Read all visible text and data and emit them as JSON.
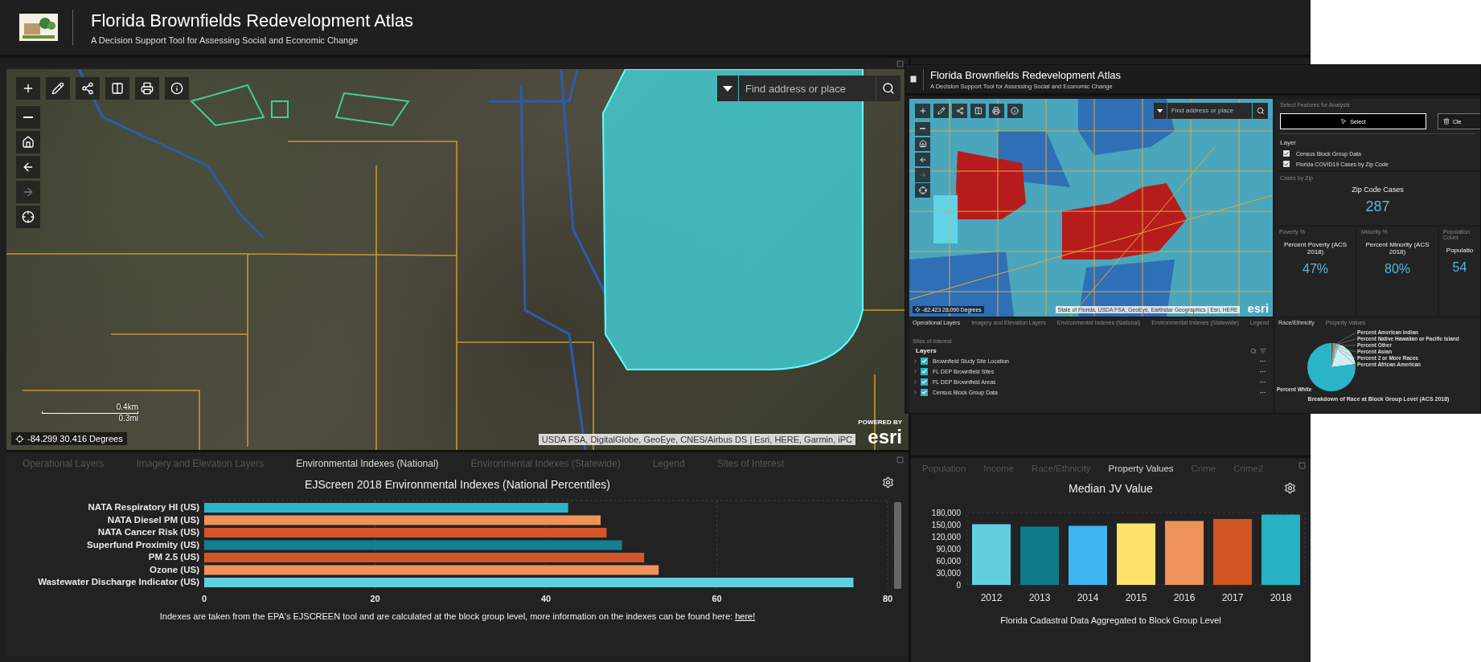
{
  "header": {
    "title": "Florida Brownfields Redevelopment Atlas",
    "subtitle": "A Decision Support Tool for Assessing Social and Economic Change"
  },
  "map": {
    "search": {
      "placeholder": "Find address or place"
    },
    "scale": [
      "0.4km",
      "0.3mi"
    ],
    "coordinates": "-84.299 30.416 Degrees",
    "attribution": "USDA FSA, DigitalGlobe, GeoEye, CNES/Airbus DS | Esri, HERE, Garmin, iPC",
    "powered_by": "POWERED BY",
    "logo": "esri"
  },
  "environment_panel": {
    "tabs": [
      {
        "label": "Operational Layers",
        "selected": false
      },
      {
        "label": "Imagery and Elevation Layers",
        "selected": false
      },
      {
        "label": "Environmental Indexes (National)",
        "selected": true
      },
      {
        "label": "Environmental Indexes (Statewide)",
        "selected": false
      },
      {
        "label": "Legend",
        "selected": false
      },
      {
        "label": "Sites of Interest",
        "selected": false
      }
    ],
    "chart_data": {
      "type": "bar",
      "orientation": "horizontal",
      "title": "EJScreen 2018 Environmental Indexes (National Percentiles)",
      "categories": [
        "NATA Respiratory HI (US)",
        "NATA Diesel PM (US)",
        "NATA Cancer Risk (US)",
        "Superfund Proximity (US)",
        "PM 2.5 (US)",
        "Ozone (US)",
        "Wastewater Discharge Indicator (US)"
      ],
      "values": [
        42.6,
        46.4,
        47.1,
        48.9,
        51.5,
        53.2,
        76
      ],
      "xlim": [
        0,
        80
      ],
      "xticks": [
        0,
        20,
        40,
        60,
        80
      ],
      "grid": true
    },
    "bars": [
      {
        "color": "#2bb5c8"
      },
      {
        "color": "#f0935a"
      },
      {
        "color": "#d2562a"
      },
      {
        "color": "#137f92"
      },
      {
        "color": "#d2562a"
      },
      {
        "color": "#f0935a"
      },
      {
        "color": "#5fcfdf"
      }
    ],
    "note": {
      "text": "Indexes are taken from the EPA's EJSCREEN tool and are calculated at the block group level, more information on the indexes can be found here:",
      "link": "here!"
    }
  },
  "property_panel": {
    "tabs": [
      {
        "label": "Population",
        "selected": false
      },
      {
        "label": "Income",
        "selected": false
      },
      {
        "label": "Race/Ethnicity",
        "selected": false
      },
      {
        "label": "Property Values",
        "selected": true
      },
      {
        "label": "Crime",
        "selected": false
      },
      {
        "label": "Crime2",
        "selected": false
      }
    ],
    "chart_data": {
      "type": "bar",
      "title": "Median JV Value",
      "xlabel": "Florida Cadastral Data Aggregated to Block Group Level",
      "categories": [
        "2012",
        "2013",
        "2014",
        "2015",
        "2016",
        "2017",
        "2018"
      ],
      "values": [
        151000,
        145000,
        147000,
        153000,
        159000,
        164000,
        175000
      ],
      "grid": true,
      "ylim": [
        0,
        180000
      ],
      "yticks": [
        {
          "value": 0,
          "label": "0"
        },
        {
          "value": 30000,
          "label": "30,000"
        },
        {
          "value": 60000,
          "label": "60,000"
        },
        {
          "value": 90000,
          "label": "90,000"
        },
        {
          "value": 120000,
          "label": "120,000"
        },
        {
          "value": 150000,
          "label": "150,000"
        },
        {
          "value": 180000,
          "label": "180,000"
        }
      ]
    },
    "bars": [
      {
        "color": "#62cfe0"
      },
      {
        "color": "#0e7a8c"
      },
      {
        "color": "#3fb6ef"
      },
      {
        "color": "#fbe26a"
      },
      {
        "color": "#f0935a"
      },
      {
        "color": "#cf5420"
      },
      {
        "color": "#27b3c5"
      }
    ]
  },
  "inset": {
    "title": "Florida Brownfields Redevelopment Atlas",
    "subtitle": "A Decision Support Tool for Assessing Social and Economic Change",
    "map": {
      "search": {
        "placeholder": "Find address or place"
      },
      "coordinates": "-82.423 28.090 Degrees",
      "attribution": "State of Florida, USDA FSA, GeoEye, Earthstar Geographics | Esri, HERE",
      "logo": "esri"
    },
    "analysis": {
      "heading": "Select Features for Analysis",
      "buttons": [
        {
          "label": "Select",
          "kind": "select"
        },
        {
          "label": "Cle",
          "kind": "clear"
        }
      ],
      "layer_heading": "Layer",
      "layers": [
        {
          "label": "Census Block Group Data",
          "checked": true
        },
        {
          "label": "Florida COVID19 Cases by Zip Code",
          "checked": true
        }
      ]
    },
    "cases": {
      "heading": "Cases by Zip",
      "title": "Zip Code Cases",
      "value": "287"
    },
    "cards": [
      {
        "heading": "Poverty %",
        "title": "Percent Poverty (ACS 2018)",
        "value": "47%"
      },
      {
        "heading": "Minority %",
        "title": "Percent Minority (ACS 2018)",
        "value": "80%"
      },
      {
        "heading": "Population Count",
        "title": "Populatio",
        "value": "54"
      }
    ],
    "layers_panel": {
      "tabs": [
        {
          "label": "Operational Layers",
          "selected": true
        },
        {
          "label": "Imagery and Elevation Layers",
          "selected": false
        },
        {
          "label": "Environmental Indexes (National)",
          "selected": false
        },
        {
          "label": "Environmental Indexes (Statewide)",
          "selected": false
        },
        {
          "label": "Legend",
          "selected": false
        },
        {
          "label": "Sites of Interest",
          "selected": false
        }
      ],
      "heading": "Layers",
      "items": [
        {
          "label": "Brownfield Study Site Location",
          "checked": true
        },
        {
          "label": "FL DEP Brownfield Sites",
          "checked": true
        },
        {
          "label": "FL DEP Brownfield Areas",
          "checked": true
        },
        {
          "label": "Census Block Group Data",
          "checked": true
        }
      ]
    },
    "race_panel": {
      "tabs": [
        {
          "label": "Race/Ethnicity",
          "selected": true
        },
        {
          "label": "Property Values",
          "selected": false
        }
      ],
      "pie_labels": [
        "Percent American Indian",
        "Percent Native Hawaiian or Pacific Island",
        "Percent Other",
        "Percent Asian",
        "Percent 2 or More Races",
        "Percent African American",
        "Percent White"
      ],
      "caption": "Breakdown of Race at Block Group Level (ACS 2018)"
    }
  }
}
